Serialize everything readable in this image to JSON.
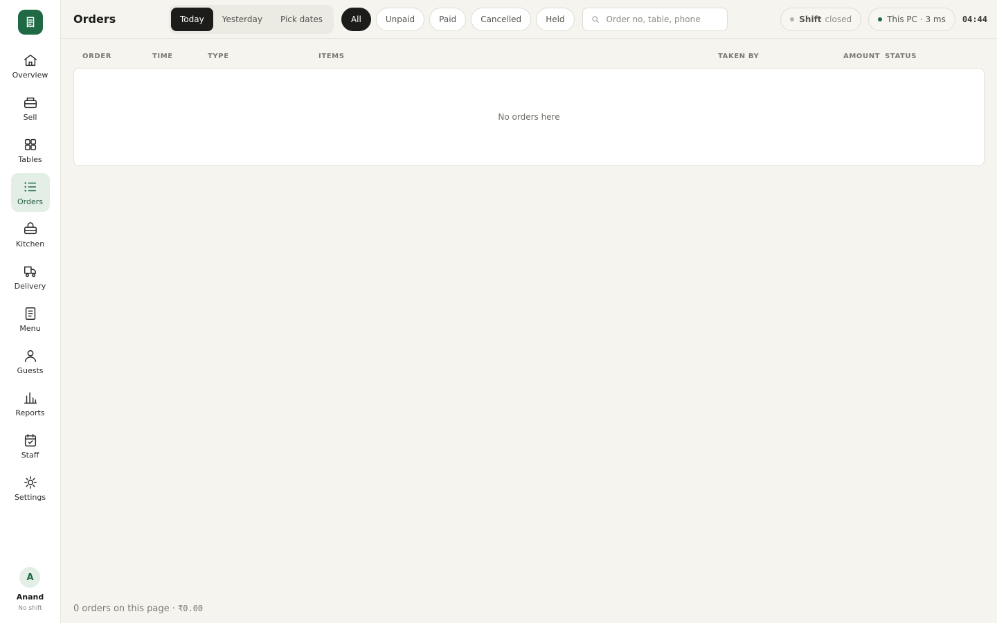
{
  "sidebar": {
    "items": [
      {
        "label": "Overview",
        "icon": "home-icon"
      },
      {
        "label": "Sell",
        "icon": "register-icon"
      },
      {
        "label": "Tables",
        "icon": "grid-icon"
      },
      {
        "label": "Orders",
        "icon": "list-icon",
        "active": true
      },
      {
        "label": "Kitchen",
        "icon": "basket-icon"
      },
      {
        "label": "Delivery",
        "icon": "delivery-icon"
      },
      {
        "label": "Menu",
        "icon": "menu-doc-icon"
      },
      {
        "label": "Guests",
        "icon": "person-icon"
      },
      {
        "label": "Reports",
        "icon": "bar-chart-icon"
      },
      {
        "label": "Staff",
        "icon": "calendar-check-icon"
      },
      {
        "label": "Settings",
        "icon": "sun-gear-icon"
      }
    ],
    "user": {
      "initial": "A",
      "name": "Anand",
      "status": "No shift"
    }
  },
  "header": {
    "title": "Orders",
    "date_tabs": [
      "Today",
      "Yesterday",
      "Pick dates"
    ],
    "active_date_tab": "Today",
    "filters": [
      "All",
      "Unpaid",
      "Paid",
      "Cancelled",
      "Held"
    ],
    "active_filter": "All",
    "search": {
      "placeholder": "Order no, table, phone",
      "value": ""
    },
    "shift": {
      "label": "Shift",
      "state": "closed"
    },
    "connection": "This PC · 3 ms",
    "clock": "04:44"
  },
  "table": {
    "columns": [
      "ORDER",
      "TIME",
      "TYPE",
      "ITEMS",
      "TAKEN BY",
      "AMOUNT",
      "STATUS"
    ],
    "empty_message": "No orders here"
  },
  "footer": {
    "summary": "0 orders on this page · ",
    "amount": "₹0.00"
  },
  "colors": {
    "accent": "#1f6a45",
    "active_nav_bg": "#e3efe6",
    "background": "#f5f4ee",
    "shift_dot": "#b5b3ac",
    "connection_dot": "#1f6a45"
  }
}
